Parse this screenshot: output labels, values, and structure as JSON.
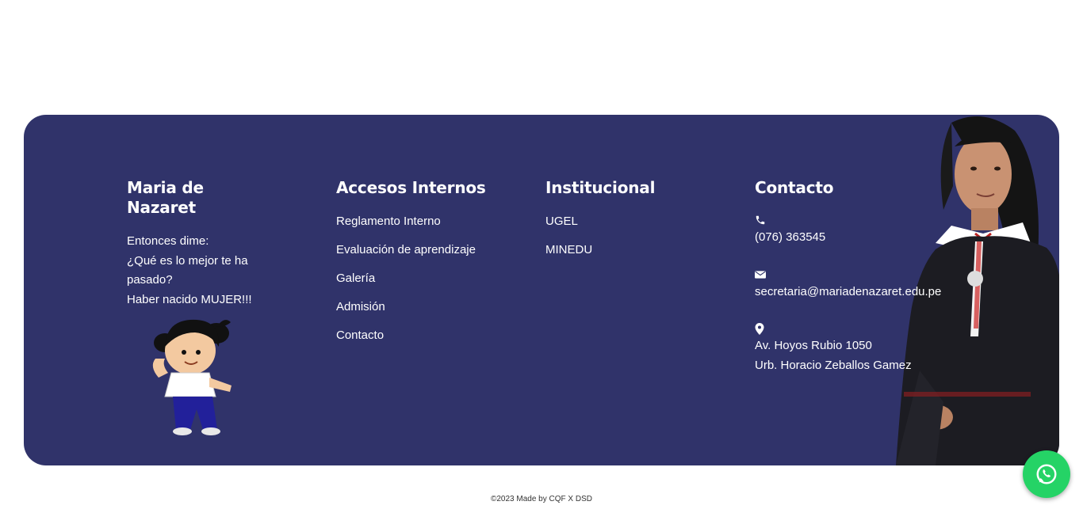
{
  "footer": {
    "col1": {
      "title": "Maria de Nazaret",
      "text_lines": [
        "Entonces dime:",
        "¿Qué es lo mejor te ha",
        "pasado?",
        "Haber nacido MUJER!!!"
      ]
    },
    "col2": {
      "title": "Accesos Internos",
      "links": [
        "Reglamento Interno",
        "Evaluación de aprendizaje",
        "Galería",
        "Admisión",
        "Contacto"
      ]
    },
    "col3": {
      "title": "Institucional",
      "links": [
        "UGEL",
        "MINEDU"
      ]
    },
    "col4": {
      "title": "Contacto",
      "phone": "(076) 363545",
      "email": "secretaria@mariadenazaret.edu.pe",
      "address_line1": "Av. Hoyos Rubio 1050",
      "address_line2": "Urb. Horacio Zeballos Gamez"
    },
    "icons": {
      "phone": "phone-icon",
      "email": "envelope-icon",
      "address": "map-marker-icon",
      "whatsapp": "whatsapp-icon"
    }
  },
  "copyright": "©2023 Made by CQF X DSD",
  "colors": {
    "footer_bg": "#30336a",
    "whatsapp": "#25d366"
  }
}
